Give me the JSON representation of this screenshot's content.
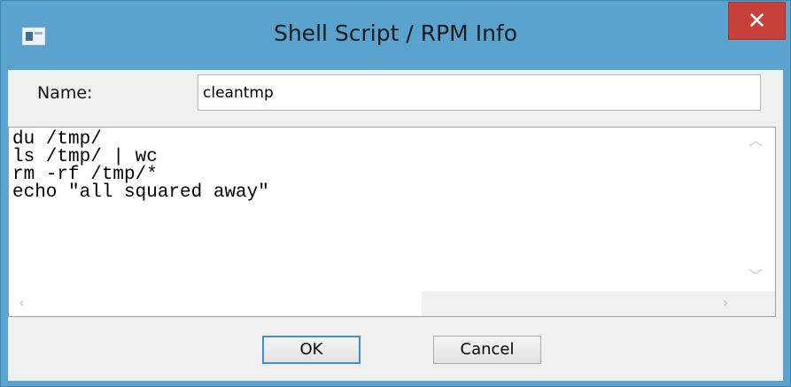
{
  "window": {
    "title": "Shell Script / RPM Info",
    "close_glyph": "✕"
  },
  "form": {
    "name_label": "Name:",
    "name_value": "cleantmp",
    "script_text": "du /tmp/\nls /tmp/ | wc\nrm -rf /tmp/*\necho \"all squared away\""
  },
  "buttons": {
    "ok_label": "OK",
    "cancel_label": "Cancel"
  },
  "icons": {
    "app": "window-app-icon",
    "close": "close-icon",
    "scroll_up": "chevron-up-icon",
    "scroll_down": "chevron-down-icon",
    "scroll_left": "chevron-left-icon",
    "scroll_right": "chevron-right-icon"
  },
  "colors": {
    "titlebar": "#5aa3cf",
    "close_button": "#c7403a",
    "default_button_border": "#3c8fd6"
  }
}
